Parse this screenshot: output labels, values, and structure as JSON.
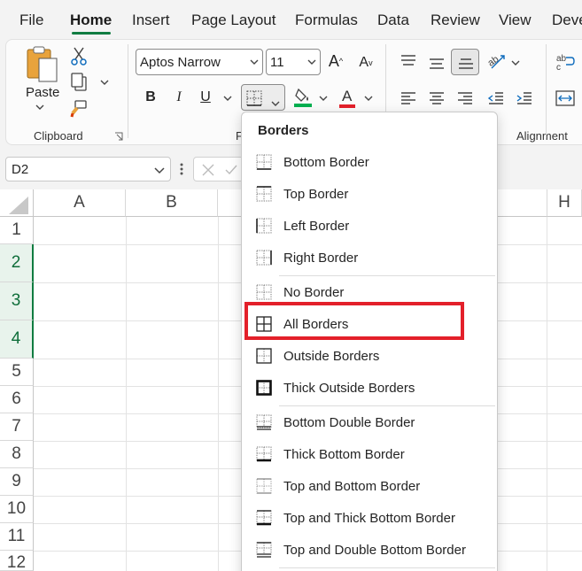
{
  "tabs": [
    {
      "label": "File",
      "active": false
    },
    {
      "label": "Home",
      "active": true
    },
    {
      "label": "Insert",
      "active": false
    },
    {
      "label": "Page Layout",
      "active": false
    },
    {
      "label": "Formulas",
      "active": false
    },
    {
      "label": "Data",
      "active": false
    },
    {
      "label": "Review",
      "active": false
    },
    {
      "label": "View",
      "active": false
    },
    {
      "label": "Deve",
      "active": false
    }
  ],
  "ribbon": {
    "paste_label": "Paste",
    "clipboard_label": "Clipboard",
    "font_name": "Aptos Narrow",
    "font_size": "11",
    "bold_label": "B",
    "italic_label": "I",
    "underline_label": "U",
    "font_group_label_partial": "F",
    "alignment_label": "Alignment"
  },
  "formula_bar": {
    "name_box": "D2"
  },
  "grid": {
    "columns": [
      "A",
      "B",
      "H"
    ],
    "rows": [
      "1",
      "2",
      "3",
      "4",
      "5",
      "6",
      "7",
      "8",
      "9",
      "10",
      "11",
      "12"
    ],
    "selected_rows": [
      "2",
      "3",
      "4"
    ]
  },
  "borders_menu": {
    "title": "Borders",
    "highlighted_item": "All Borders",
    "items": [
      {
        "label": "Bottom Border",
        "icon": "bottom-border-icon"
      },
      {
        "label": "Top Border",
        "icon": "top-border-icon"
      },
      {
        "label": "Left Border",
        "icon": "left-border-icon"
      },
      {
        "label": "Right Border",
        "icon": "right-border-icon"
      },
      {
        "label": "No Border",
        "icon": "no-border-icon"
      },
      {
        "label": "All Borders",
        "icon": "all-borders-icon"
      },
      {
        "label": "Outside Borders",
        "icon": "outside-borders-icon"
      },
      {
        "label": "Thick Outside Borders",
        "icon": "thick-outside-borders-icon"
      },
      {
        "label": "Bottom Double Border",
        "icon": "bottom-double-border-icon"
      },
      {
        "label": "Thick Bottom Border",
        "icon": "thick-bottom-border-icon"
      },
      {
        "label": "Top and Bottom Border",
        "icon": "top-and-bottom-border-icon"
      },
      {
        "label": "Top and Thick Bottom Border",
        "icon": "top-and-thick-bottom-border-icon"
      },
      {
        "label": "Top and Double Bottom Border",
        "icon": "top-and-double-bottom-border-icon"
      }
    ]
  },
  "colors": {
    "accent_green": "#107c41",
    "highlight_red": "#e3202a",
    "fill_color_bar": "#00b050",
    "font_color_bar": "#e3202a"
  }
}
